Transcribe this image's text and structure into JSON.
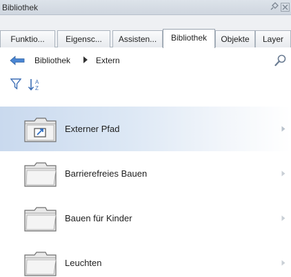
{
  "window": {
    "title": "Bibliothek",
    "icons": [
      "pin-icon",
      "close-icon"
    ]
  },
  "tabs": [
    {
      "label": "Funktio..."
    },
    {
      "label": "Eigensc..."
    },
    {
      "label": "Assisten..."
    },
    {
      "label": "Bibliothek",
      "active": true
    },
    {
      "label": "Objekte"
    },
    {
      "label": "Layer"
    }
  ],
  "nav": {
    "back_icon": "back-arrow-icon",
    "breadcrumb": [
      "Bibliothek",
      "Extern"
    ],
    "separator_icon": "triangle-right-icon",
    "search_icon": "search-icon"
  },
  "toolbar": {
    "icons": [
      "filter-icon",
      "sort-icon"
    ]
  },
  "items": [
    {
      "label": "Externer Pfad",
      "icon": "folder-link-icon",
      "selected": true
    },
    {
      "label": "Barrierefreies Bauen",
      "icon": "folder-icon"
    },
    {
      "label": "Bauen für Kinder",
      "icon": "folder-icon"
    },
    {
      "label": "Leuchten",
      "icon": "folder-icon"
    }
  ],
  "colors": {
    "selection": "#c9d9ee",
    "accent": "#3a7bd5",
    "tab_border": "#aab3bd"
  }
}
